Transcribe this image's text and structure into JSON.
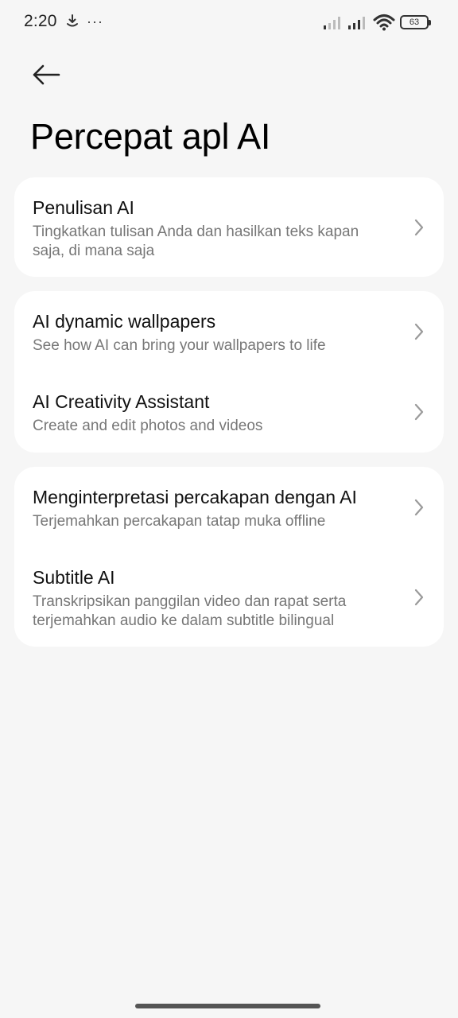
{
  "status_bar": {
    "time": "2:20",
    "more": "···",
    "battery": "63"
  },
  "header": {
    "title": "Percepat apl AI"
  },
  "groups": [
    {
      "items": [
        {
          "title": "Penulisan AI",
          "subtitle": "Tingkatkan tulisan Anda dan hasilkan teks kapan saja, di mana saja"
        }
      ]
    },
    {
      "items": [
        {
          "title": "AI dynamic wallpapers",
          "subtitle": "See how AI can bring your wallpapers to life"
        },
        {
          "title": "AI Creativity Assistant",
          "subtitle": "Create and edit photos and videos"
        }
      ]
    },
    {
      "items": [
        {
          "title": "Menginterpretasi percakapan dengan AI",
          "subtitle": "Terjemahkan percakapan tatap muka offline"
        },
        {
          "title": "Subtitle AI",
          "subtitle": "Transkripsikan panggilan video dan rapat serta terjemahkan audio ke dalam subtitle bilingual"
        }
      ]
    }
  ],
  "colors": {
    "background": "#f6f6f6",
    "card": "#ffffff",
    "title": "#111111",
    "subtitle": "#777777",
    "chevron": "#9a9a9a"
  }
}
